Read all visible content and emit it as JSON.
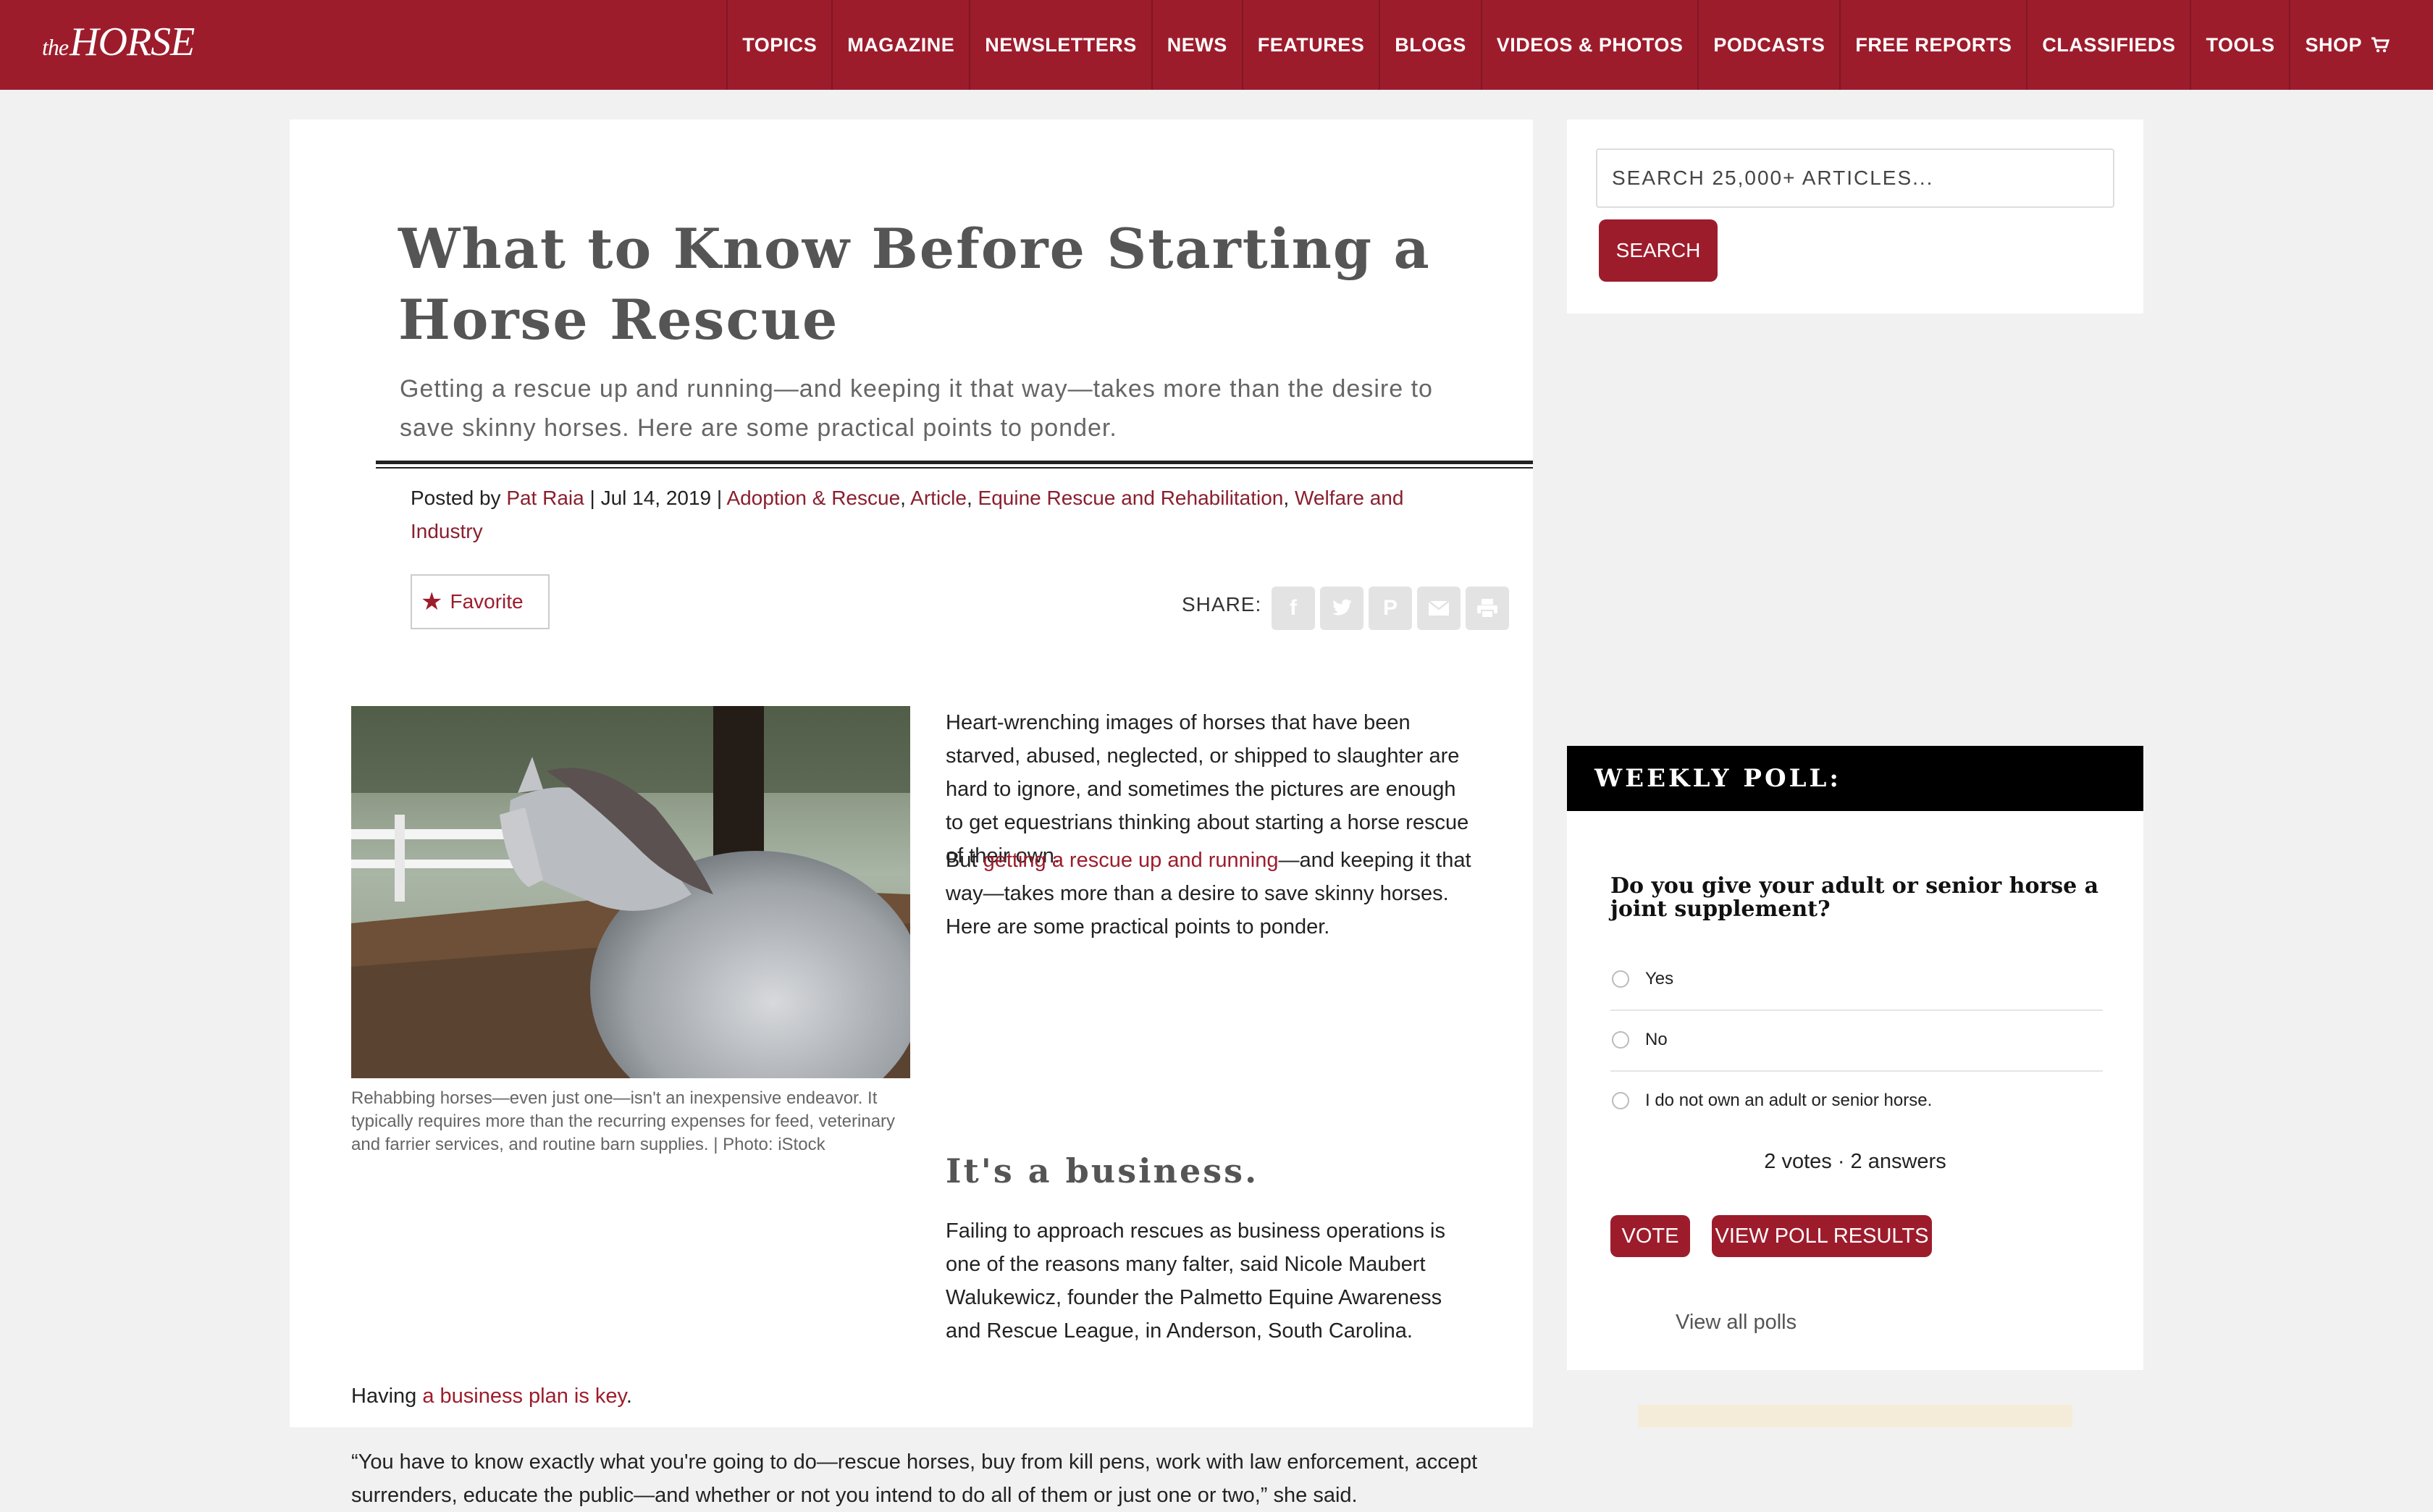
{
  "header": {
    "logo_the": "the",
    "logo_name": "HORSE",
    "nav": [
      "TOPICS",
      "MAGAZINE",
      "NEWSLETTERS",
      "NEWS",
      "FEATURES",
      "BLOGS",
      "VIDEOS & PHOTOS",
      "PODCASTS",
      "FREE REPORTS",
      "CLASSIFIEDS",
      "TOOLS",
      "SHOP"
    ]
  },
  "article": {
    "title": "What to Know Before Starting a Horse Rescue",
    "dek": "Getting a rescue up and running—and keeping it that way—takes more than the desire to save skinny horses. Here are some practical points to ponder.",
    "meta": {
      "posted_by": "Posted by",
      "author": "Pat Raia",
      "sep": "|",
      "date": "Jul 14, 2019",
      "categories": [
        "Adoption & Rescue",
        "Article",
        "Equine Rescue and Rehabilitation",
        "Welfare and Industry"
      ]
    },
    "favorite_label": "Favorite",
    "share_label": "SHARE:",
    "share_icons": [
      "facebook-icon",
      "twitter-icon",
      "pinterest-icon",
      "email-icon",
      "print-icon"
    ],
    "caption": "Rehabbing horses—even just one—isn't an inexpensive endeavor. It typically requires more than the recurring expenses for feed, veterinary and farrier services, and routine barn supplies. | Photo: iStock",
    "p1": "Heart-wrenching images of horses that have been starved, abused, neglected, or shipped to slaughter are hard to ignore, and sometimes the pictures are enough to get equestrians thinking about starting a horse rescue of their own.",
    "p2_pre": "But ",
    "p2_link": "getting a rescue up and running",
    "p2_post": "—and keeping it that way—takes more than a desire to save skinny horses. Here are some practical points to ponder.",
    "subhead": "It's a business.",
    "p3": "Failing to approach rescues as business operations is one of the reasons many falter, said Nicole Maubert Walukewicz, founder the Palmetto Equine Awareness and Rescue League, in Anderson, South Carolina.",
    "p4_pre": "Having ",
    "p4_link": "a business plan is key",
    "p4_post": ".",
    "p5": "“You have to know exactly what you're going to do—rescue horses, buy from kill pens, work with law enforcement, accept surrenders, educate the public—and whether or not you intend to do all of them or just one or two,” she said."
  },
  "sidebar": {
    "search_placeholder": "SEARCH 25,000+ ARTICLES...",
    "search_button": "SEARCH",
    "poll": {
      "header": "WEEKLY POLL:",
      "question": "Do you give your adult or senior horse a joint supplement?",
      "options": [
        "Yes",
        "No",
        "I do not own an adult or senior horse."
      ],
      "votes": "2 votes · 2 answers",
      "vote_button": "VOTE",
      "results_button": "VIEW POLL RESULTS",
      "view_all": "View all polls"
    }
  },
  "colors": {
    "brand": "#9d1c2c",
    "link": "#8a1f2e",
    "background": "#f1f1f1"
  }
}
